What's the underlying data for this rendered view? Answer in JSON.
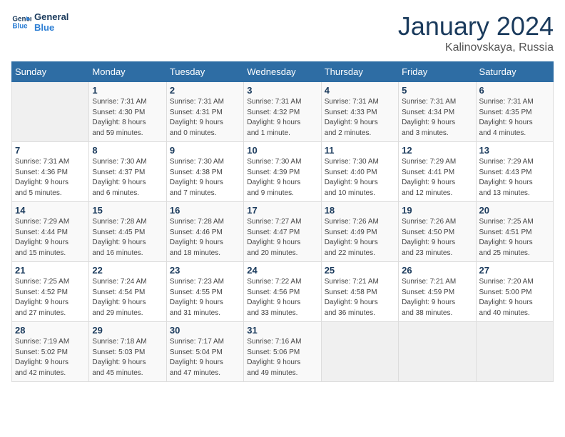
{
  "logo": {
    "line1": "General",
    "line2": "Blue"
  },
  "title": "January 2024",
  "subtitle": "Kalinovskaya, Russia",
  "colors": {
    "header_bg": "#2e6da4",
    "title_color": "#1a3a5c"
  },
  "days_of_week": [
    "Sunday",
    "Monday",
    "Tuesday",
    "Wednesday",
    "Thursday",
    "Friday",
    "Saturday"
  ],
  "weeks": [
    [
      {
        "day": "",
        "content": ""
      },
      {
        "day": "1",
        "content": "Sunrise: 7:31 AM\nSunset: 4:30 PM\nDaylight: 8 hours\nand 59 minutes."
      },
      {
        "day": "2",
        "content": "Sunrise: 7:31 AM\nSunset: 4:31 PM\nDaylight: 9 hours\nand 0 minutes."
      },
      {
        "day": "3",
        "content": "Sunrise: 7:31 AM\nSunset: 4:32 PM\nDaylight: 9 hours\nand 1 minute."
      },
      {
        "day": "4",
        "content": "Sunrise: 7:31 AM\nSunset: 4:33 PM\nDaylight: 9 hours\nand 2 minutes."
      },
      {
        "day": "5",
        "content": "Sunrise: 7:31 AM\nSunset: 4:34 PM\nDaylight: 9 hours\nand 3 minutes."
      },
      {
        "day": "6",
        "content": "Sunrise: 7:31 AM\nSunset: 4:35 PM\nDaylight: 9 hours\nand 4 minutes."
      }
    ],
    [
      {
        "day": "7",
        "content": "Sunrise: 7:31 AM\nSunset: 4:36 PM\nDaylight: 9 hours\nand 5 minutes."
      },
      {
        "day": "8",
        "content": "Sunrise: 7:30 AM\nSunset: 4:37 PM\nDaylight: 9 hours\nand 6 minutes."
      },
      {
        "day": "9",
        "content": "Sunrise: 7:30 AM\nSunset: 4:38 PM\nDaylight: 9 hours\nand 7 minutes."
      },
      {
        "day": "10",
        "content": "Sunrise: 7:30 AM\nSunset: 4:39 PM\nDaylight: 9 hours\nand 9 minutes."
      },
      {
        "day": "11",
        "content": "Sunrise: 7:30 AM\nSunset: 4:40 PM\nDaylight: 9 hours\nand 10 minutes."
      },
      {
        "day": "12",
        "content": "Sunrise: 7:29 AM\nSunset: 4:41 PM\nDaylight: 9 hours\nand 12 minutes."
      },
      {
        "day": "13",
        "content": "Sunrise: 7:29 AM\nSunset: 4:43 PM\nDaylight: 9 hours\nand 13 minutes."
      }
    ],
    [
      {
        "day": "14",
        "content": "Sunrise: 7:29 AM\nSunset: 4:44 PM\nDaylight: 9 hours\nand 15 minutes."
      },
      {
        "day": "15",
        "content": "Sunrise: 7:28 AM\nSunset: 4:45 PM\nDaylight: 9 hours\nand 16 minutes."
      },
      {
        "day": "16",
        "content": "Sunrise: 7:28 AM\nSunset: 4:46 PM\nDaylight: 9 hours\nand 18 minutes."
      },
      {
        "day": "17",
        "content": "Sunrise: 7:27 AM\nSunset: 4:47 PM\nDaylight: 9 hours\nand 20 minutes."
      },
      {
        "day": "18",
        "content": "Sunrise: 7:26 AM\nSunset: 4:49 PM\nDaylight: 9 hours\nand 22 minutes."
      },
      {
        "day": "19",
        "content": "Sunrise: 7:26 AM\nSunset: 4:50 PM\nDaylight: 9 hours\nand 23 minutes."
      },
      {
        "day": "20",
        "content": "Sunrise: 7:25 AM\nSunset: 4:51 PM\nDaylight: 9 hours\nand 25 minutes."
      }
    ],
    [
      {
        "day": "21",
        "content": "Sunrise: 7:25 AM\nSunset: 4:52 PM\nDaylight: 9 hours\nand 27 minutes."
      },
      {
        "day": "22",
        "content": "Sunrise: 7:24 AM\nSunset: 4:54 PM\nDaylight: 9 hours\nand 29 minutes."
      },
      {
        "day": "23",
        "content": "Sunrise: 7:23 AM\nSunset: 4:55 PM\nDaylight: 9 hours\nand 31 minutes."
      },
      {
        "day": "24",
        "content": "Sunrise: 7:22 AM\nSunset: 4:56 PM\nDaylight: 9 hours\nand 33 minutes."
      },
      {
        "day": "25",
        "content": "Sunrise: 7:21 AM\nSunset: 4:58 PM\nDaylight: 9 hours\nand 36 minutes."
      },
      {
        "day": "26",
        "content": "Sunrise: 7:21 AM\nSunset: 4:59 PM\nDaylight: 9 hours\nand 38 minutes."
      },
      {
        "day": "27",
        "content": "Sunrise: 7:20 AM\nSunset: 5:00 PM\nDaylight: 9 hours\nand 40 minutes."
      }
    ],
    [
      {
        "day": "28",
        "content": "Sunrise: 7:19 AM\nSunset: 5:02 PM\nDaylight: 9 hours\nand 42 minutes."
      },
      {
        "day": "29",
        "content": "Sunrise: 7:18 AM\nSunset: 5:03 PM\nDaylight: 9 hours\nand 45 minutes."
      },
      {
        "day": "30",
        "content": "Sunrise: 7:17 AM\nSunset: 5:04 PM\nDaylight: 9 hours\nand 47 minutes."
      },
      {
        "day": "31",
        "content": "Sunrise: 7:16 AM\nSunset: 5:06 PM\nDaylight: 9 hours\nand 49 minutes."
      },
      {
        "day": "",
        "content": ""
      },
      {
        "day": "",
        "content": ""
      },
      {
        "day": "",
        "content": ""
      }
    ]
  ]
}
